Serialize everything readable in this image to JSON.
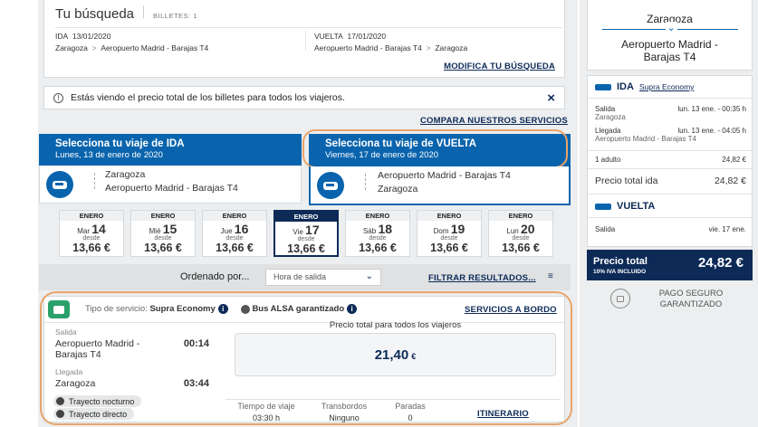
{
  "search": {
    "title": "Tu búsqueda",
    "tickets_label": "BILLETES: 1",
    "ida_label": "IDA",
    "ida_date": "13/01/2020",
    "ida_from": "Zaragoza",
    "ida_to": "Aeropuerto Madrid - Barajas T4",
    "vuelta_label": "VUELTA",
    "vuelta_date": "17/01/2020",
    "vuelta_from": "Aeropuerto Madrid - Barajas T4",
    "vuelta_to": "Zaragoza",
    "arrow": ">",
    "modify_link": "MODIFICA TU BÚSQUEDA"
  },
  "notice": {
    "text": "Estás viendo el precio total de los billetes para todos los viajeros.",
    "close": "×",
    "compare_link": "COMPARA NUESTROS SERVICIOS"
  },
  "ida_tab": {
    "title": "Selecciona tu viaje de IDA",
    "date": "Lunes, 13 de enero de 2020",
    "from": "Zaragoza",
    "to": "Aeropuerto Madrid - Barajas T4"
  },
  "vuelta_tab": {
    "title": "Selecciona tu viaje de VUELTA",
    "date": "Viernes, 17 de enero de 2020",
    "from": "Aeropuerto Madrid - Barajas T4",
    "to": "Zaragoza"
  },
  "dates": [
    {
      "month": "ENERO",
      "weekday": "Mar",
      "day": "14",
      "from": "desde",
      "price": "13,66 €",
      "selected": false
    },
    {
      "month": "ENERO",
      "weekday": "Mié",
      "day": "15",
      "from": "desde",
      "price": "13,66 €",
      "selected": false
    },
    {
      "month": "ENERO",
      "weekday": "Jue",
      "day": "16",
      "from": "desde",
      "price": "13,66 €",
      "selected": false
    },
    {
      "month": "ENERO",
      "weekday": "Vie",
      "day": "17",
      "from": "desde",
      "price": "13,66 €",
      "selected": true
    },
    {
      "month": "ENERO",
      "weekday": "Sáb",
      "day": "18",
      "from": "desde",
      "price": "13,66 €",
      "selected": false
    },
    {
      "month": "ENERO",
      "weekday": "Dom",
      "day": "19",
      "from": "desde",
      "price": "13,66 €",
      "selected": false
    },
    {
      "month": "ENERO",
      "weekday": "Lun",
      "day": "20",
      "from": "desde",
      "price": "13,66 €",
      "selected": false
    }
  ],
  "sort": {
    "label": "Ordenado por...",
    "value": "Hora de salida",
    "filter_link": "FILTRAR RESULTADOS..."
  },
  "result": {
    "service_type_label": "Tipo de servicio:",
    "service_type": "Supra Economy",
    "guarantee": "Bus ALSA garantizado",
    "onboard_link": "SERVICIOS A BORDO",
    "departure_label": "Salida",
    "departure_place": "Aeropuerto Madrid - Barajas T4",
    "departure_time": "00:14",
    "arrival_label": "Llegada",
    "arrival_place": "Zaragoza",
    "arrival_time": "03:44",
    "tag_night": "Trayecto nocturno",
    "tag_direct": "Trayecto directo",
    "price_caption": "Precio total para todos los viajeros",
    "price_int": "21,40",
    "price_cur": "€",
    "travel_time_label": "Tiempo de viaje",
    "travel_time": "03:30 h",
    "transfers_label": "Transbordos",
    "transfers": "Ninguno",
    "stops_label": "Paradas",
    "stops": "0",
    "itinerary_link": "ITINERARIO"
  },
  "sidebar": {
    "origin": "Zaragoza",
    "destination": "Aeropuerto Madrid - Barajas T4",
    "ida_title": "IDA",
    "ida_service": "Supra Economy",
    "salida_label": "Salida",
    "salida_place": "Zaragoza",
    "salida_time": "lun. 13 ene. - 00:35 h",
    "llegada_label": "Llegada",
    "llegada_place": "Aeropuerto Madrid - Barajas T4",
    "llegada_time": "lun. 13 ene. - 04:05 h",
    "adult_label": "1 adulto",
    "adult_price": "24,82 €",
    "total_ida_label": "Precio total ida",
    "total_ida": "24,82 €",
    "vuelta_title": "VUELTA",
    "vuelta_salida_label": "Salida",
    "vuelta_salida_date": "vie. 17 ene.",
    "total_label": "Precio total",
    "vat_label": "10% IVA INCLUIDO",
    "total_price": "24,82 €",
    "secure_line1": "PAGO SEGURO",
    "secure_line2": "GARANTIZADO"
  }
}
